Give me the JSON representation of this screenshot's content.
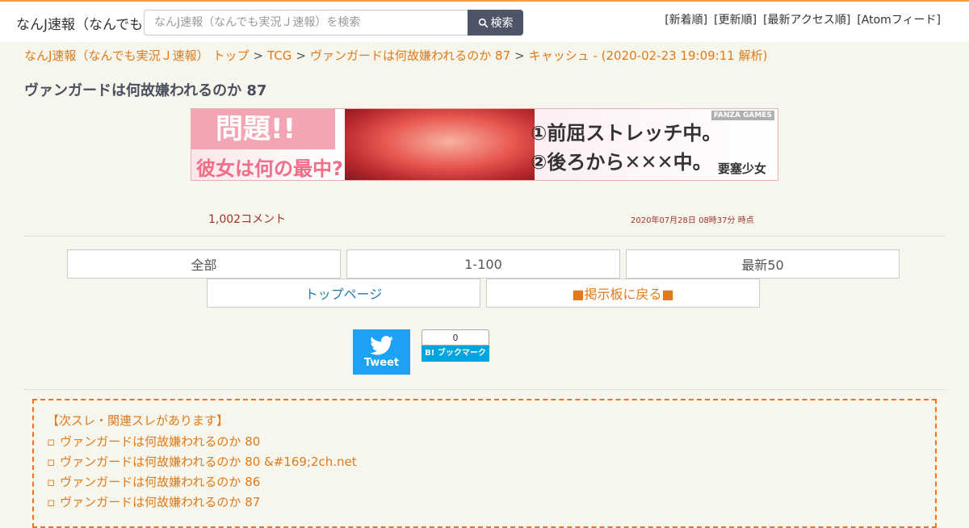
{
  "header": {
    "site_title": "なんJ速報（なんでも実況Ｊ速報）",
    "search_placeholder": "なんJ速報（なんでも実況Ｊ速報）を検索",
    "search_button": "検索",
    "nav": [
      "[新着順]",
      "[更新順]",
      "[最新アクセス順]",
      "[Atomフィード]"
    ]
  },
  "breadcrumb": {
    "items": [
      "なんJ速報（なんでも実況Ｊ速報） トップ",
      "TCG",
      "ヴァンガードは何故嫌われるのか 87",
      "キャッシュ - (2020-02-23 19:09:11 解析)"
    ],
    "separator": ">"
  },
  "thread": {
    "title": "ヴァンガードは何故嫌われるのか 87",
    "comment_count": "1,002コメント",
    "timestamp": "2020年07月28日 08時37分 時点"
  },
  "banner": {
    "question": "問題!!",
    "question_sub": "彼女は何の最中?",
    "line1": "①前屈ストレッチ中。",
    "line2": "②後ろから✕✕✕中。",
    "brand": "FANZA GAMES",
    "game": "要塞少女"
  },
  "buttons": {
    "all": "全部",
    "range": "1-100",
    "latest": "最新50",
    "top_page": "トップページ",
    "back": "■掲示板に戻る■"
  },
  "share": {
    "tweet": "Tweet",
    "hatena_count": "0",
    "hatena_label": "B! ブックマーク"
  },
  "related": {
    "heading": "【次スレ・関連スレがあります】",
    "items": [
      "ヴァンガードは何故嫌われるのか 80",
      "ヴァンガードは何故嫌われるのか 80 &#169;2ch.net",
      "ヴァンガードは何故嫌われるのか 86",
      "ヴァンガードは何故嫌われるのか 87"
    ]
  },
  "colors": {
    "accent": "#e07a1a",
    "background": "#f7f6ec",
    "search_button": "#4d5566",
    "twitter": "#1da1f2",
    "hatena": "#00a4de"
  }
}
